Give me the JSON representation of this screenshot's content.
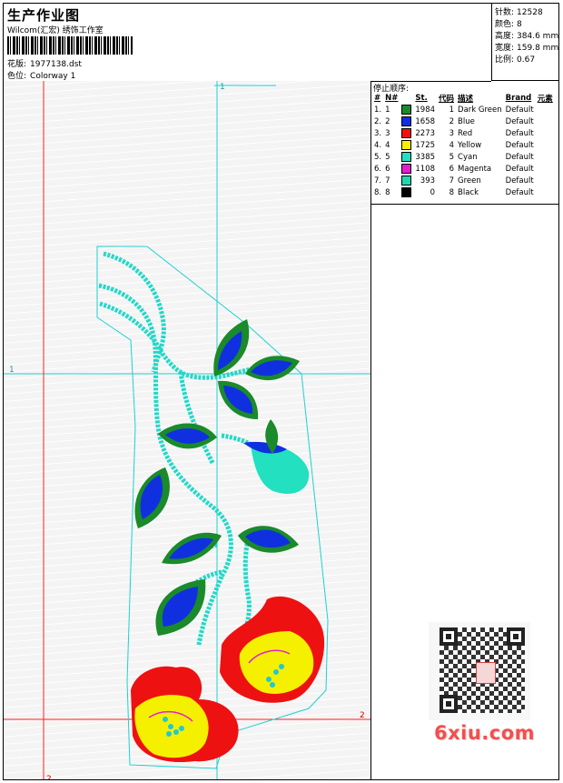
{
  "header": {
    "title": "生产作业图",
    "subtitle": "Wilcom(汇宏) 绣饰工作室",
    "design_label": "花版:",
    "design_value": "1977138.dst",
    "colorway_label": "色位:",
    "colorway_value": "Colorway 1"
  },
  "stats": [
    {
      "label": "针数:",
      "value": "12528"
    },
    {
      "label": "颜色:",
      "value": "8"
    },
    {
      "label": "高度:",
      "value": "384.6 mm"
    },
    {
      "label": "宽度:",
      "value": "159.8 mm"
    },
    {
      "label": "比例:",
      "value": "0.67"
    }
  ],
  "stop_sequence": {
    "title": "停止顺序:",
    "columns": [
      "#",
      "N#",
      "St.",
      "代码",
      "描述",
      "Brand",
      "元素"
    ],
    "rows": [
      {
        "idx": "1.",
        "n": "1",
        "color": "#1a8a2a",
        "stitches": "1984",
        "code": "1",
        "desc": "Dark Green",
        "brand": "Default"
      },
      {
        "idx": "2.",
        "n": "2",
        "color": "#1030e0",
        "stitches": "1658",
        "code": "2",
        "desc": "Blue",
        "brand": "Default"
      },
      {
        "idx": "3.",
        "n": "3",
        "color": "#ee1111",
        "stitches": "2273",
        "code": "3",
        "desc": "Red",
        "brand": "Default"
      },
      {
        "idx": "4.",
        "n": "4",
        "color": "#f5f000",
        "stitches": "1725",
        "code": "4",
        "desc": "Yellow",
        "brand": "Default"
      },
      {
        "idx": "5.",
        "n": "5",
        "color": "#22e0c0",
        "stitches": "3385",
        "code": "5",
        "desc": "Cyan",
        "brand": "Default"
      },
      {
        "idx": "6.",
        "n": "6",
        "color": "#e020d0",
        "stitches": "1108",
        "code": "6",
        "desc": "Magenta",
        "brand": "Default"
      },
      {
        "idx": "7.",
        "n": "7",
        "color": "#20d8b0",
        "stitches": "393",
        "code": "7",
        "desc": "Green",
        "brand": "Default"
      },
      {
        "idx": "8.",
        "n": "8",
        "color": "#000000",
        "stitches": "0",
        "code": "8",
        "desc": "Black",
        "brand": "Default"
      }
    ]
  },
  "guides": {
    "h1": "1",
    "h2": "2",
    "v1": "1",
    "v2": "2"
  },
  "watermark": "6xiu.com"
}
